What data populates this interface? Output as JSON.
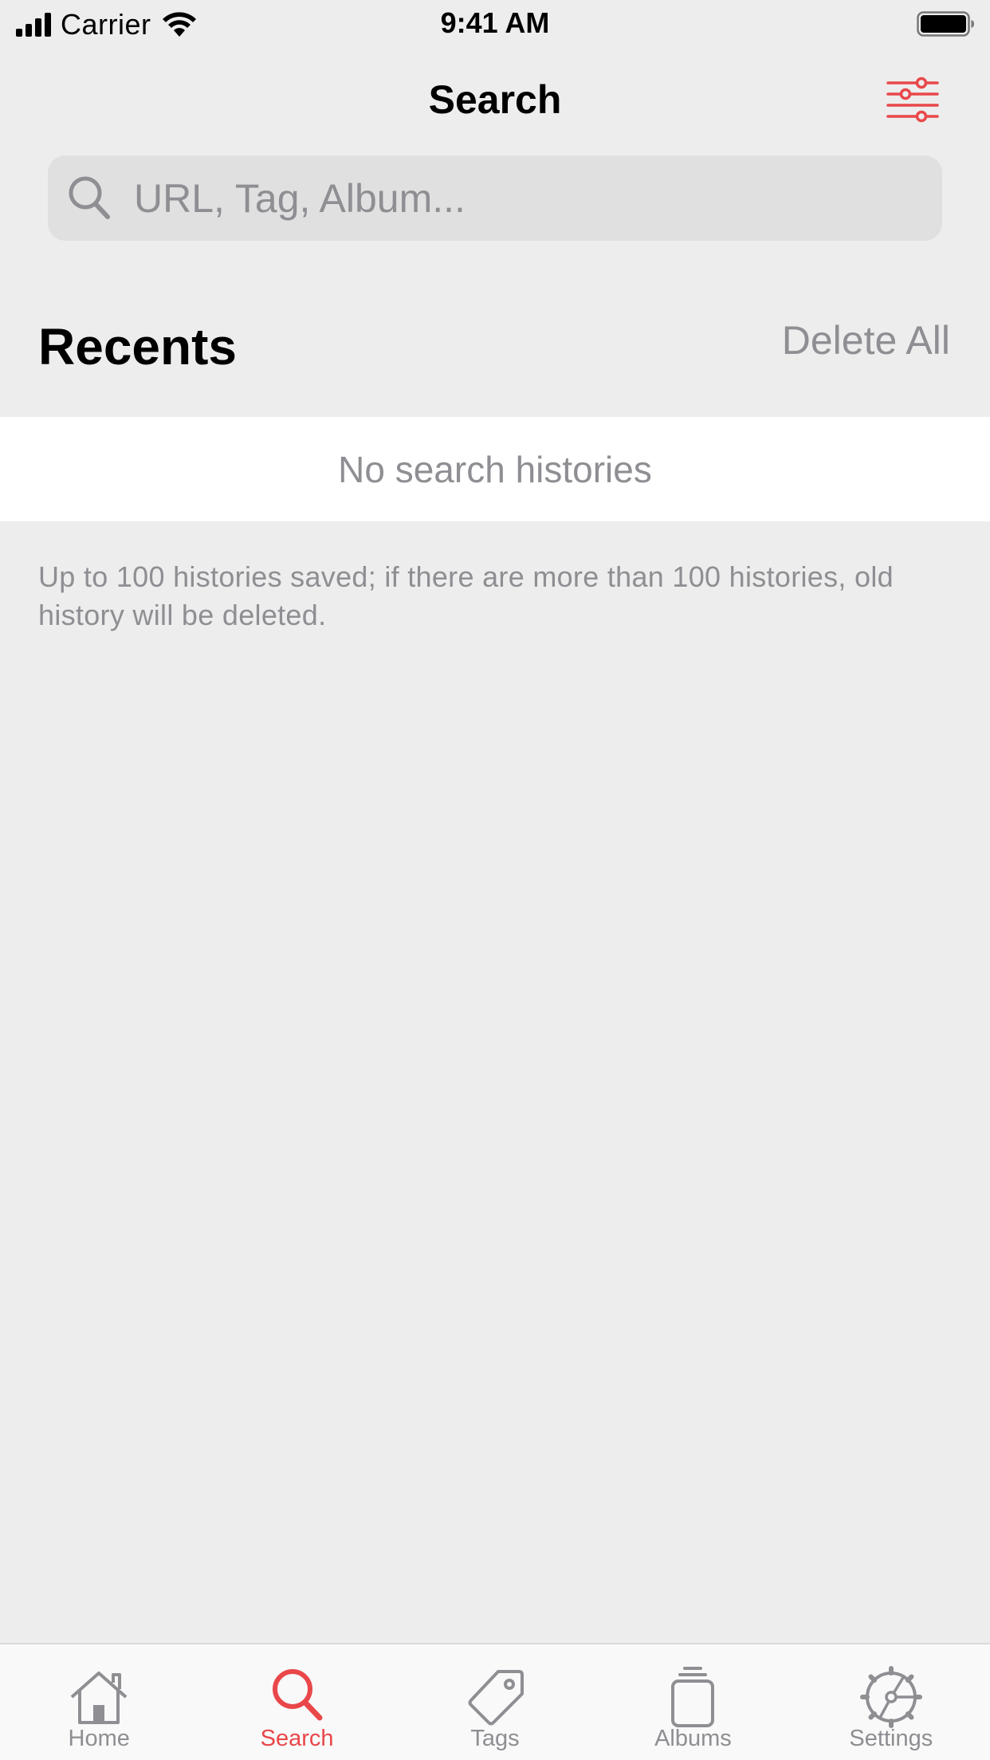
{
  "status_bar": {
    "carrier": "Carrier",
    "time": "9:41 AM"
  },
  "nav": {
    "title": "Search",
    "filter_icon": "sliders-icon"
  },
  "search": {
    "placeholder": "URL, Tag, Album...",
    "value": "",
    "icon": "search-icon"
  },
  "recents": {
    "title": "Recents",
    "delete_all_label": "Delete All",
    "empty_text": "No search histories",
    "footer_note": "Up to 100 histories saved; if there are more than 100 histories, old history will be deleted."
  },
  "tab_bar": {
    "tabs": [
      {
        "label": "Home",
        "icon": "home-icon",
        "active": false
      },
      {
        "label": "Search",
        "icon": "search-icon",
        "active": true
      },
      {
        "label": "Tags",
        "icon": "tag-icon",
        "active": false
      },
      {
        "label": "Albums",
        "icon": "albums-icon",
        "active": false
      },
      {
        "label": "Settings",
        "icon": "gear-icon",
        "active": false
      }
    ]
  },
  "colors": {
    "accent": "#E9474A",
    "secondary_text": "#8E8E93",
    "background": "#EDEDED"
  }
}
